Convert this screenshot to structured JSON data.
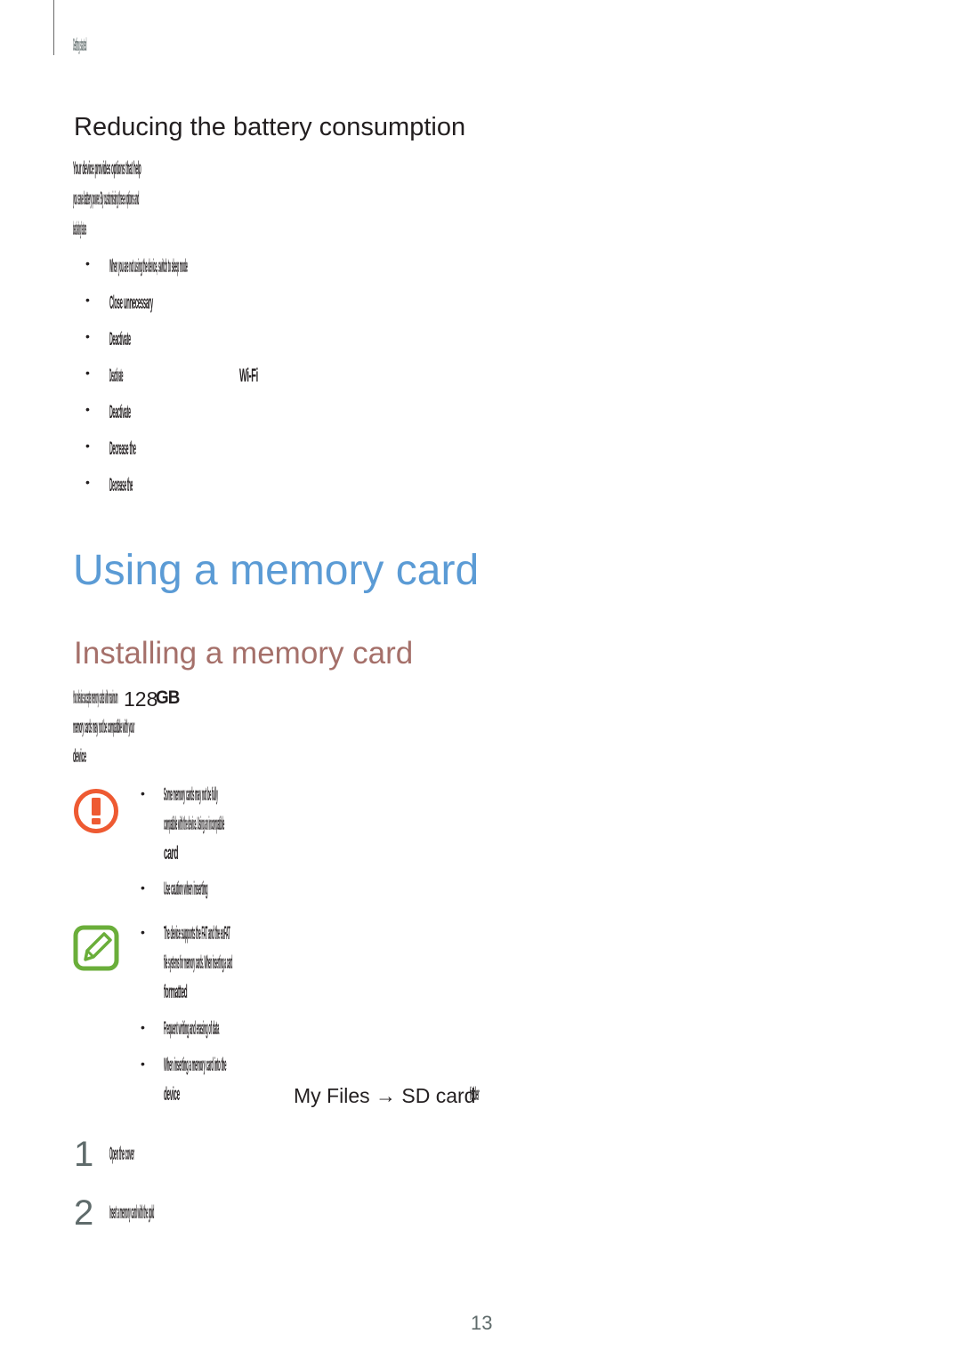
{
  "running_head": "Getting started",
  "section_battery": {
    "title": "Reducing the battery consumption",
    "intro_lines": [
      "Your device provides options that help",
      "you save battery power. By customising these options and",
      "deactivating features"
    ],
    "bullets": [
      {
        "text": "When you are not using the device, switch to sleep mode"
      },
      {
        "text": "Close unnecessary"
      },
      {
        "text": "Deactivate"
      },
      {
        "text": "Deactivate",
        "trail": "Wi-Fi"
      },
      {
        "text": "Deactivate"
      },
      {
        "text": "Decrease the"
      },
      {
        "text": "Decrease the"
      }
    ]
  },
  "chapter": {
    "title": "Using a memory card"
  },
  "section_install": {
    "title": "Installing a memory card",
    "intro_line1_pre": "Your device accepts memory cards with maximum",
    "intro_line1_num": "128",
    "intro_line1_post": "GB",
    "intro_lines": [
      "memory cards may not be compatible with your",
      "device"
    ],
    "caution": {
      "icon": "caution-icon",
      "bullets": [
        {
          "lines": [
            "Some memory cards may not be fully",
            "compatible with the device. Using an incompatible",
            "card"
          ]
        },
        {
          "lines": [
            "Use caution when inserting"
          ]
        }
      ]
    },
    "note": {
      "icon": "note-icon",
      "bullets": [
        {
          "lines": [
            "The device supports the FAT and the exFAT",
            "file systems for memory cards. When inserting a card",
            "formatted"
          ]
        },
        {
          "lines": [
            "Frequent writing and erasing of data"
          ]
        },
        {
          "lines": [
            "When inserting a memory card into the",
            "device"
          ],
          "link": "My Files → SD card",
          "link_suffix": "folder"
        }
      ]
    },
    "steps": [
      {
        "num": "1",
        "text": "Open the cover"
      },
      {
        "num": "2",
        "text": "Insert a memory card with the gold"
      }
    ]
  },
  "page_number": "13"
}
